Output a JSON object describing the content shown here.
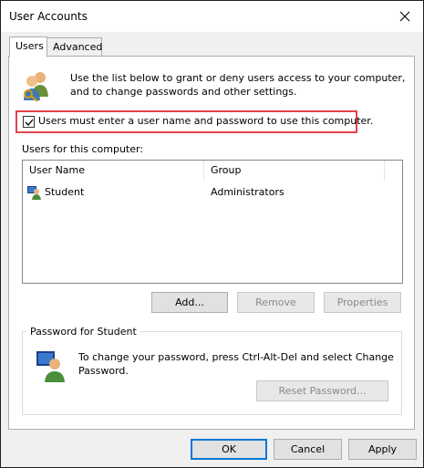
{
  "window": {
    "title": "User Accounts"
  },
  "tabs": [
    {
      "label": "Users",
      "active": true
    },
    {
      "label": "Advanced",
      "active": false
    }
  ],
  "intro": {
    "text": "Use the list below to grant or deny users access to your computer, and to change passwords and other settings.",
    "icon": "users-keys-icon"
  },
  "require_login": {
    "label": "Users must enter a user name and password to use this computer.",
    "checked": true,
    "highlight_color": "#e0454a"
  },
  "users_list": {
    "label": "Users for this computer:",
    "columns": [
      "User Name",
      "Group"
    ],
    "rows": [
      {
        "name": "Student",
        "group": "Administrators",
        "icon": "user-icon"
      }
    ]
  },
  "list_buttons": {
    "add": "Add...",
    "remove": "Remove",
    "properties": "Properties"
  },
  "password_group": {
    "title": "Password for Student",
    "text": "To change your password, press Ctrl-Alt-Del and select Change Password.",
    "reset_label": "Reset Password...",
    "icon": "user-monitor-icon"
  },
  "dialog_buttons": {
    "ok": "OK",
    "cancel": "Cancel",
    "apply": "Apply"
  },
  "colors": {
    "focus_accent": "#0078d7"
  }
}
